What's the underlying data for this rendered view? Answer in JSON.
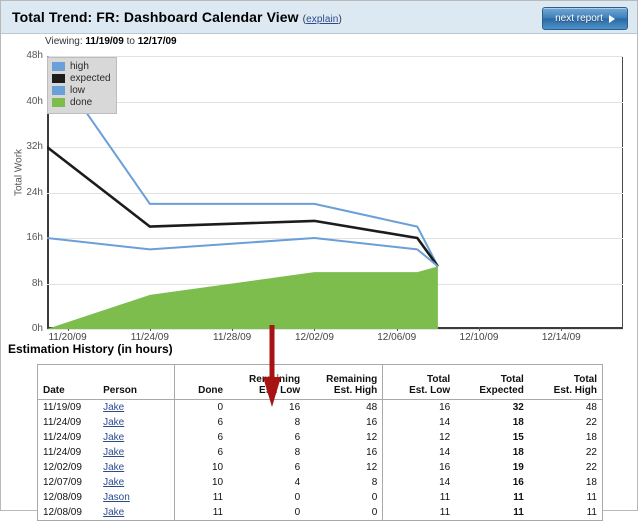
{
  "header": {
    "title": "Total Trend: FR: Dashboard Calendar View",
    "paren_open": "(",
    "explain_label": "explain",
    "paren_close": ")",
    "next_report_label": "next report"
  },
  "viewing": {
    "prefix": "Viewing:",
    "start_date": "11/19/09",
    "to": "to",
    "end_date": "12/17/09"
  },
  "chart_data": {
    "type": "line",
    "title": "",
    "xlabel": "",
    "ylabel": "Total Work",
    "ylim": [
      0,
      48
    ],
    "ytick_labels": [
      "0h",
      "8h",
      "16h",
      "24h",
      "32h",
      "40h",
      "48h"
    ],
    "ytick_values": [
      0,
      8,
      16,
      24,
      32,
      40,
      48
    ],
    "xtick_labels": [
      "11/20/09",
      "11/24/09",
      "11/28/09",
      "12/02/09",
      "12/06/09",
      "12/10/09",
      "12/14/09"
    ],
    "grid": true,
    "legend_position": "top-left",
    "legend": [
      {
        "label": "high",
        "color": "#6a9fd8"
      },
      {
        "label": "expected",
        "color": "#1c1c1c"
      },
      {
        "label": "low",
        "color": "#6a9fd8"
      },
      {
        "label": "done",
        "color": "#7cbd4e"
      }
    ],
    "x": [
      "11/19/09",
      "11/24/09",
      "12/02/09",
      "12/07/09",
      "12/08/09",
      "12/17/09"
    ],
    "series": [
      {
        "name": "high",
        "color": "#6a9fd8",
        "values": [
          48,
          22,
          22,
          18,
          11,
          null
        ]
      },
      {
        "name": "expected",
        "color": "#1c1c1c",
        "values": [
          32,
          18,
          19,
          16,
          11,
          null
        ]
      },
      {
        "name": "low",
        "color": "#6a9fd8",
        "values": [
          16,
          14,
          16,
          14,
          11,
          null
        ]
      },
      {
        "name": "done",
        "color": "#7cbd4e",
        "values": [
          0,
          6,
          10,
          10,
          11,
          null
        ],
        "fill": true
      }
    ],
    "annotation": {
      "type": "down-arrow",
      "color": "#a81212",
      "near_tick": "12/02/09"
    }
  },
  "estimation_history": {
    "title": "Estimation History (in hours)",
    "columns": [
      {
        "key": "date",
        "line1": "",
        "line2": "Date"
      },
      {
        "key": "person",
        "line1": "",
        "line2": "Person"
      },
      {
        "key": "done",
        "line1": "",
        "line2": "Done"
      },
      {
        "key": "rlow",
        "line1": "Remaining",
        "line2": "Est. Low"
      },
      {
        "key": "rhigh",
        "line1": "Remaining",
        "line2": "Est. High"
      },
      {
        "key": "tlow",
        "line1": "Total",
        "line2": "Est. Low"
      },
      {
        "key": "texp",
        "line1": "Total",
        "line2": "Expected"
      },
      {
        "key": "thigh",
        "line1": "Total",
        "line2": "Est. High"
      }
    ],
    "rows": [
      {
        "date": "11/19/09",
        "person": "Jake",
        "done": "0",
        "rlow": "16",
        "rhigh": "48",
        "tlow": "16",
        "texp": "32",
        "thigh": "48"
      },
      {
        "date": "11/24/09",
        "person": "Jake",
        "done": "6",
        "rlow": "8",
        "rhigh": "16",
        "tlow": "14",
        "texp": "18",
        "thigh": "22"
      },
      {
        "date": "11/24/09",
        "person": "Jake",
        "done": "6",
        "rlow": "6",
        "rhigh": "12",
        "tlow": "12",
        "texp": "15",
        "thigh": "18"
      },
      {
        "date": "11/24/09",
        "person": "Jake",
        "done": "6",
        "rlow": "8",
        "rhigh": "16",
        "tlow": "14",
        "texp": "18",
        "thigh": "22"
      },
      {
        "date": "12/02/09",
        "person": "Jake",
        "done": "10",
        "rlow": "6",
        "rhigh": "12",
        "tlow": "16",
        "texp": "19",
        "thigh": "22"
      },
      {
        "date": "12/07/09",
        "person": "Jake",
        "done": "10",
        "rlow": "4",
        "rhigh": "8",
        "tlow": "14",
        "texp": "16",
        "thigh": "18"
      },
      {
        "date": "12/08/09",
        "person": "Jason",
        "done": "11",
        "rlow": "0",
        "rhigh": "0",
        "tlow": "11",
        "texp": "11",
        "thigh": "11"
      },
      {
        "date": "12/08/09",
        "person": "Jake",
        "done": "11",
        "rlow": "0",
        "rhigh": "0",
        "tlow": "11",
        "texp": "11",
        "thigh": "11"
      }
    ]
  },
  "colors": {
    "header_band": "#dce9f2",
    "accent_blue": "#6a9fd8",
    "done_green": "#7cbd4e",
    "expected_black": "#1c1c1c",
    "arrow_red": "#a81212",
    "link_blue": "#2b4b8f"
  }
}
